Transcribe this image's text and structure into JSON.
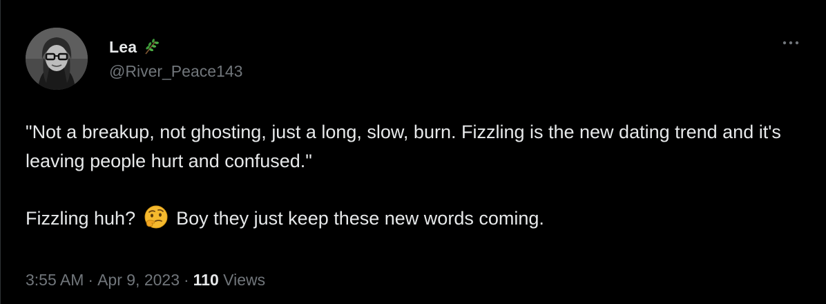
{
  "tweet": {
    "author": {
      "display_name": "Lea",
      "name_emoji": "herb-icon",
      "handle": "@River_Peace143",
      "avatar": "avatar-photo"
    },
    "more_icon": "more-horizontal-icon",
    "text": {
      "paragraph1": "\"Not a breakup, not ghosting, just a long, slow, burn. Fizzling is the new dating trend and it's leaving people hurt and confused.\"",
      "paragraph2_before": "Fizzling huh? ",
      "paragraph2_emoji": "thinking-face-icon",
      "paragraph2_after": " Boy they just keep these new words coming."
    },
    "meta": {
      "time": "3:55 AM",
      "separator": "·",
      "date": "Apr 9, 2023",
      "views_count": "110",
      "views_label": "Views"
    }
  },
  "colors": {
    "background": "#000000",
    "text_primary": "#e7e9ea",
    "text_secondary": "#71767b",
    "border": "#2f3336"
  }
}
